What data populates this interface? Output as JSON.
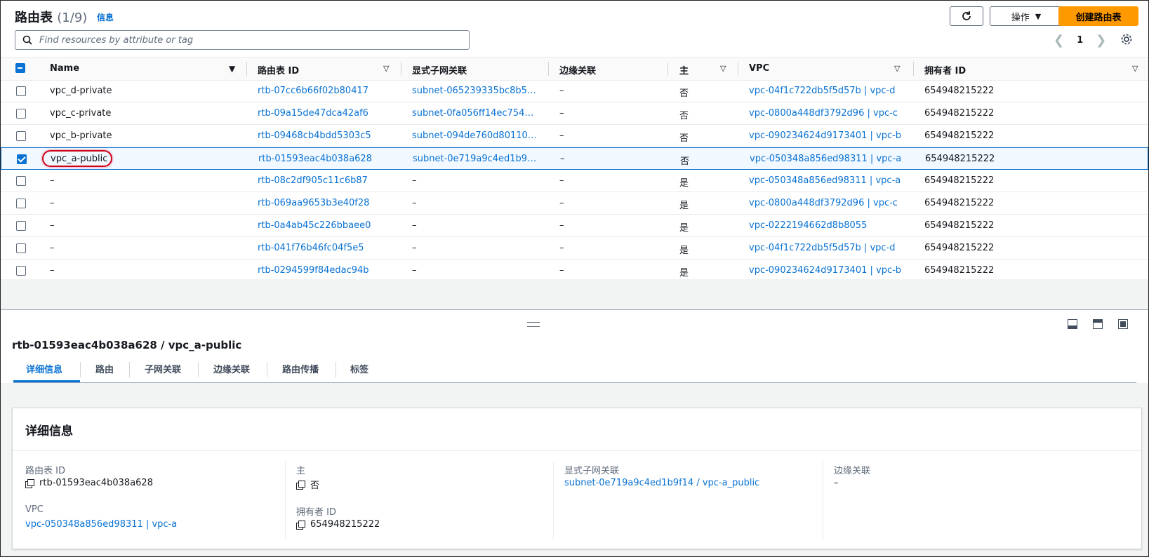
{
  "header": {
    "title": "路由表",
    "count": "(1/9)",
    "info": "信息",
    "actions_label": "操作",
    "create_label": "创建路由表"
  },
  "search": {
    "placeholder": "Find resources by attribute or tag"
  },
  "pagination": {
    "page": "1"
  },
  "table": {
    "columns": [
      "Name",
      "路由表 ID",
      "显式子网关联",
      "边缘关联",
      "主",
      "VPC",
      "拥有者 ID"
    ],
    "rows": [
      {
        "name": "vpc_d-private",
        "id": "rtb-07cc6b66f02b80417",
        "subnet": "subnet-065239335bc8b5…",
        "edge": "–",
        "main": "否",
        "vpc": "vpc-04f1c722db5f5d57b | vpc-d",
        "owner": "654948215222",
        "selected": false
      },
      {
        "name": "vpc_c-private",
        "id": "rtb-09a15de47dca42af6",
        "subnet": "subnet-0fa056ff14ec754…",
        "edge": "–",
        "main": "否",
        "vpc": "vpc-0800a448df3792d96 | vpc-c",
        "owner": "654948215222",
        "selected": false
      },
      {
        "name": "vpc_b-private",
        "id": "rtb-09468cb4bdd5303c5",
        "subnet": "subnet-094de760d80110…",
        "edge": "–",
        "main": "否",
        "vpc": "vpc-090234624d9173401 | vpc-b",
        "owner": "654948215222",
        "selected": false
      },
      {
        "name": "vpc_a-public",
        "id": "rtb-01593eac4b038a628",
        "subnet": "subnet-0e719a9c4ed1b9…",
        "edge": "–",
        "main": "否",
        "vpc": "vpc-050348a856ed98311 | vpc-a",
        "owner": "654948215222",
        "selected": true
      },
      {
        "name": "–",
        "id": "rtb-08c2df905c11c6b87",
        "subnet": "–",
        "edge": "–",
        "main": "是",
        "vpc": "vpc-050348a856ed98311 | vpc-a",
        "owner": "654948215222",
        "selected": false
      },
      {
        "name": "–",
        "id": "rtb-069aa9653b3e40f28",
        "subnet": "–",
        "edge": "–",
        "main": "是",
        "vpc": "vpc-0800a448df3792d96 | vpc-c",
        "owner": "654948215222",
        "selected": false
      },
      {
        "name": "–",
        "id": "rtb-0a4ab45c226bbaee0",
        "subnet": "–",
        "edge": "–",
        "main": "是",
        "vpc": "vpc-0222194662d8b8055",
        "owner": "654948215222",
        "selected": false
      },
      {
        "name": "–",
        "id": "rtb-041f76b46fc04f5e5",
        "subnet": "–",
        "edge": "–",
        "main": "是",
        "vpc": "vpc-04f1c722db5f5d57b | vpc-d",
        "owner": "654948215222",
        "selected": false
      },
      {
        "name": "–",
        "id": "rtb-0294599f84edac94b",
        "subnet": "–",
        "edge": "–",
        "main": "是",
        "vpc": "vpc-090234624d9173401 | vpc-b",
        "owner": "654948215222",
        "selected": false
      }
    ]
  },
  "detail": {
    "title": "rtb-01593eac4b038a628 / vpc_a-public",
    "tabs": [
      "详细信息",
      "路由",
      "子网关联",
      "边缘关联",
      "路由传播",
      "标签"
    ],
    "card_title": "详细信息",
    "fields": {
      "rt_id_label": "路由表 ID",
      "rt_id_value": "rtb-01593eac4b038a628",
      "main_label": "主",
      "main_value": "否",
      "subnet_label": "显式子网关联",
      "subnet_value": "subnet-0e719a9c4ed1b9f14 / vpc-a_public",
      "edge_label": "边缘关联",
      "edge_value": "–",
      "vpc_label": "VPC",
      "vpc_value": "vpc-050348a856ed98311 | vpc-a",
      "owner_label": "拥有者 ID",
      "owner_value": "654948215222"
    }
  },
  "colors": {
    "accent": "#0972d3",
    "primary_button": "#ff9900",
    "highlight": "#d0021b"
  }
}
